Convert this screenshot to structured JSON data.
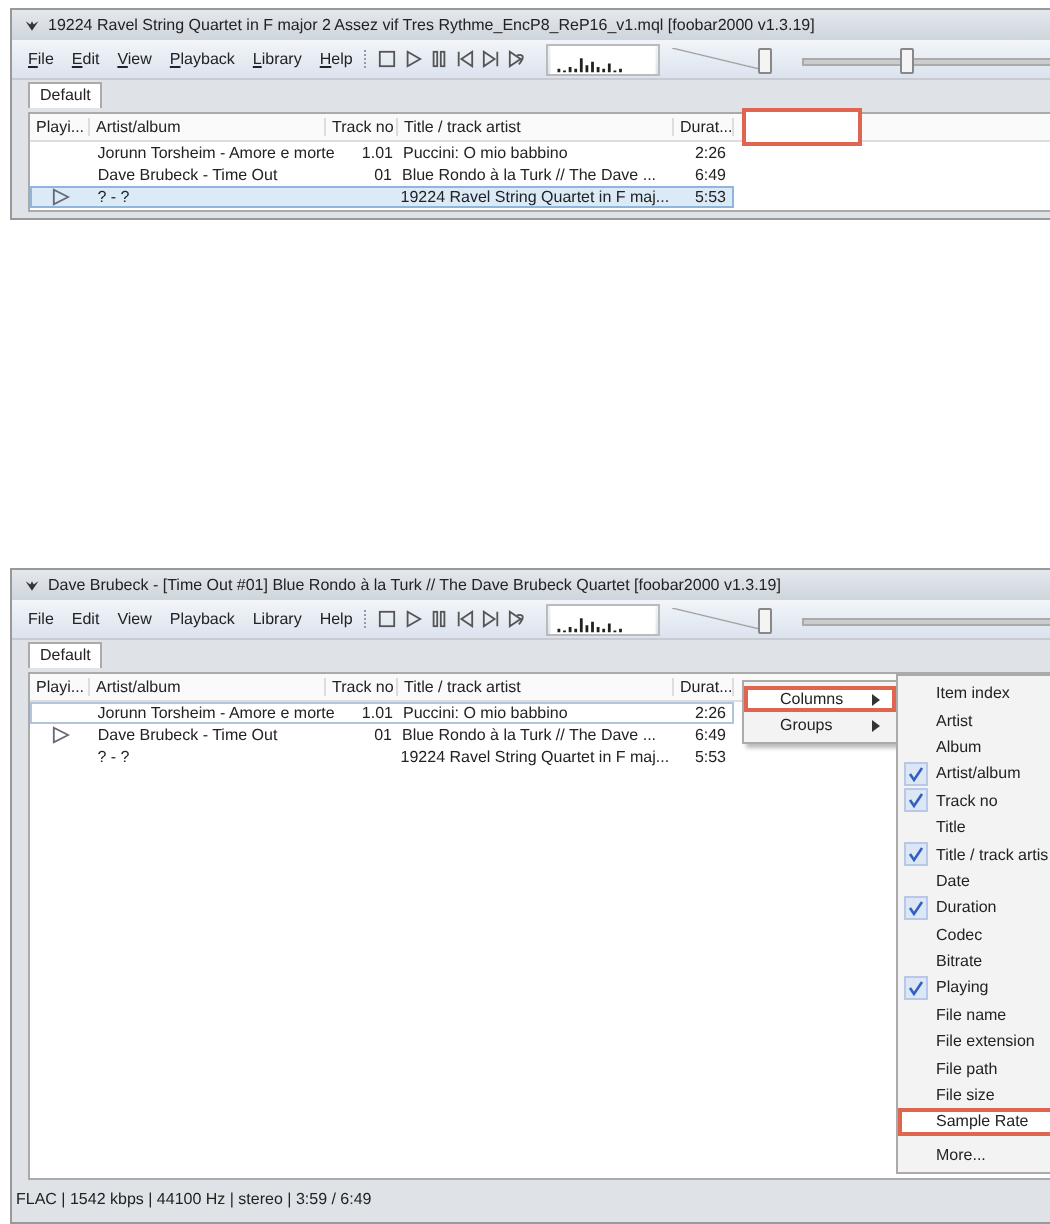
{
  "windows": [
    {
      "title": "19224 Ravel String Quartet in F major 2 Assez vif Tres Rythme_EncP8_ReP16_v1.mql   [foobar2000 v1.3.19]",
      "menu": [
        {
          "label": "File",
          "underlined": true
        },
        {
          "label": "Edit",
          "underlined": true
        },
        {
          "label": "View",
          "underlined": true
        },
        {
          "label": "Playback",
          "underlined": true
        },
        {
          "label": "Library",
          "underlined": true
        },
        {
          "label": "Help",
          "underlined": true
        }
      ],
      "volume": {
        "level": 0.92
      },
      "seek": {
        "level": 0.4
      },
      "tabs": [
        {
          "label": "Default",
          "selected": true
        }
      ],
      "columns": [
        "Playi...",
        "Artist/album",
        "Track no",
        "Title / track artist",
        "Durat..."
      ],
      "header_callout": true,
      "rows": [
        {
          "playing": false,
          "selected": false,
          "focused": false,
          "artist_album": "Jorunn Torsheim - Amore e morte",
          "track_no": "1.01",
          "title": "Puccini: O mio babbino",
          "duration": "2:26"
        },
        {
          "playing": false,
          "selected": false,
          "focused": false,
          "artist_album": "Dave Brubeck - Time Out",
          "track_no": "01",
          "title": "Blue Rondo à la Turk // The Dave ...",
          "duration": "6:49"
        },
        {
          "playing": true,
          "selected": true,
          "focused": true,
          "artist_album": "? - ?",
          "track_no": "",
          "title": "19224 Ravel String Quartet in F maj...",
          "duration": "5:53"
        }
      ]
    },
    {
      "title": "Dave Brubeck - [Time Out #01] Blue Rondo à la Turk // The Dave Brubeck Quartet   [foobar2000 v1.3.19]",
      "menu": [
        {
          "label": "File",
          "underlined": false
        },
        {
          "label": "Edit",
          "underlined": false
        },
        {
          "label": "View",
          "underlined": false
        },
        {
          "label": "Playback",
          "underlined": false
        },
        {
          "label": "Library",
          "underlined": false
        },
        {
          "label": "Help",
          "underlined": false
        }
      ],
      "volume": {
        "level": 0.92
      },
      "tabs": [
        {
          "label": "Default",
          "selected": true
        }
      ],
      "columns": [
        "Playi...",
        "Artist/album",
        "Track no",
        "Title / track artist",
        "Durat..."
      ],
      "rows": [
        {
          "playing": false,
          "selected": false,
          "focused": true,
          "artist_album": "Jorunn Torsheim - Amore e morte",
          "track_no": "1.01",
          "title": "Puccini: O mio babbino",
          "duration": "2:26"
        },
        {
          "playing": true,
          "selected": false,
          "focused": false,
          "artist_album": "Dave Brubeck - Time Out",
          "track_no": "01",
          "title": "Blue Rondo à la Turk // The Dave ...",
          "duration": "6:49"
        },
        {
          "playing": false,
          "selected": false,
          "focused": false,
          "artist_album": "? - ?",
          "track_no": "",
          "title": "19224 Ravel String Quartet in F maj...",
          "duration": "5:53"
        }
      ],
      "context_menu": [
        {
          "label": "Columns",
          "highlighted": true
        },
        {
          "label": "Groups",
          "highlighted": false
        }
      ],
      "submenu": [
        {
          "label": "Item index",
          "checked": false,
          "highlighted": false
        },
        {
          "label": "Artist",
          "checked": false,
          "highlighted": false
        },
        {
          "label": "Album",
          "checked": false,
          "highlighted": false
        },
        {
          "label": "Artist/album",
          "checked": true,
          "highlighted": false
        },
        {
          "label": "Track no",
          "checked": true,
          "highlighted": false
        },
        {
          "label": "Title",
          "checked": false,
          "highlighted": false
        },
        {
          "label": "Title / track artis",
          "checked": true,
          "highlighted": false
        },
        {
          "label": "Date",
          "checked": false,
          "highlighted": false
        },
        {
          "label": "Duration",
          "checked": true,
          "highlighted": false
        },
        {
          "label": "Codec",
          "checked": false,
          "highlighted": false
        },
        {
          "label": "Bitrate",
          "checked": false,
          "highlighted": false
        },
        {
          "label": "Playing",
          "checked": true,
          "highlighted": false
        },
        {
          "label": "File name",
          "checked": false,
          "highlighted": false
        },
        {
          "label": "File extension",
          "checked": false,
          "highlighted": false
        },
        {
          "label": "File path",
          "checked": false,
          "highlighted": false
        },
        {
          "label": "File size",
          "checked": false,
          "highlighted": false
        },
        {
          "label": "Sample Rate",
          "checked": false,
          "highlighted": true
        },
        {
          "label": "More...",
          "checked": false,
          "highlighted": false
        }
      ],
      "status_bar": "FLAC | 1542 kbps | 44100 Hz | stereo | 3:59 / 6:49"
    }
  ]
}
